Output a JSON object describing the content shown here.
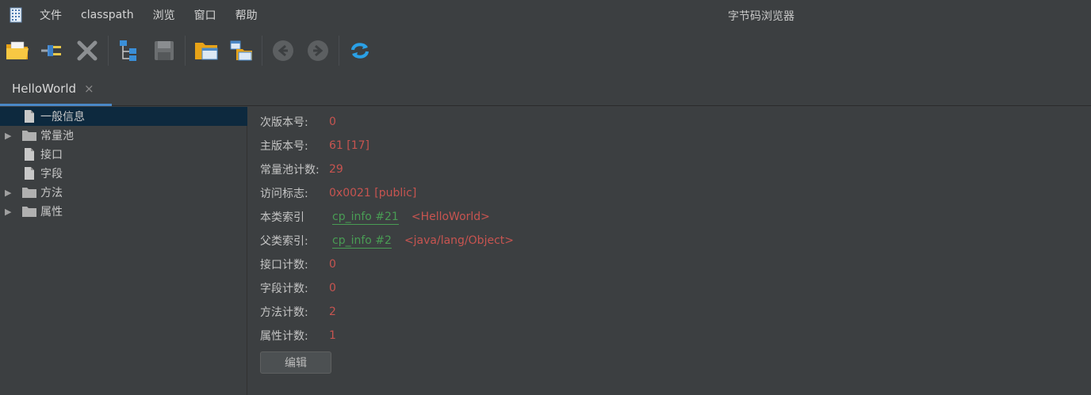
{
  "menu": {
    "items": [
      "文件",
      "classpath",
      "浏览",
      "窗口",
      "帮助"
    ]
  },
  "window_title": "字节码浏览器",
  "toolbar": {
    "buttons": [
      {
        "icon": "open-folder-icon"
      },
      {
        "icon": "plug-icon"
      },
      {
        "icon": "close-x-icon"
      },
      {
        "icon": "tree-hierarchy-icon"
      },
      {
        "icon": "save-disk-icon"
      },
      {
        "icon": "browse-folder-icon"
      },
      {
        "icon": "window-folder-icon"
      },
      {
        "icon": "back-arrow-icon"
      },
      {
        "icon": "forward-arrow-icon"
      },
      {
        "icon": "refresh-icon"
      }
    ]
  },
  "tabs": [
    {
      "label": "HelloWorld",
      "close": "×"
    }
  ],
  "tree": [
    {
      "label": "一般信息",
      "expandable": false,
      "icon": "file-icon",
      "selected": true
    },
    {
      "label": "常量池",
      "expandable": true,
      "icon": "folder-icon",
      "selected": false
    },
    {
      "label": "接口",
      "expandable": false,
      "icon": "file-icon",
      "selected": false
    },
    {
      "label": "字段",
      "expandable": false,
      "icon": "file-icon",
      "selected": false
    },
    {
      "label": "方法",
      "expandable": true,
      "icon": "folder-icon",
      "selected": false
    },
    {
      "label": "属性",
      "expandable": true,
      "icon": "folder-icon",
      "selected": false
    }
  ],
  "tree_arrow": "▶",
  "info": {
    "minor_version": {
      "label": "次版本号:",
      "value": "0"
    },
    "major_version": {
      "label": "主版本号:",
      "value": "61 [17]"
    },
    "cp_count": {
      "label": "常量池计数:",
      "value": "29"
    },
    "access_flags": {
      "label": "访问标志:",
      "value": "0x0021 [public]"
    },
    "this_class": {
      "label": "本类索引",
      "link": "cp_info #21",
      "target": "<HelloWorld>"
    },
    "super_class": {
      "label": "父类索引:",
      "link": "cp_info #2",
      "target": "<java/lang/Object>"
    },
    "interfaces_count": {
      "label": "接口计数:",
      "value": "0"
    },
    "fields_count": {
      "label": "字段计数:",
      "value": "0"
    },
    "methods_count": {
      "label": "方法计数:",
      "value": "2"
    },
    "attributes_count": {
      "label": "属性计数:",
      "value": "1"
    }
  },
  "edit_button": "编辑",
  "colors": {
    "background": "#3c3f41",
    "selection": "#0d293e",
    "value_red": "#c75450",
    "link_green": "#499c54",
    "tab_accent": "#4a88c7"
  }
}
